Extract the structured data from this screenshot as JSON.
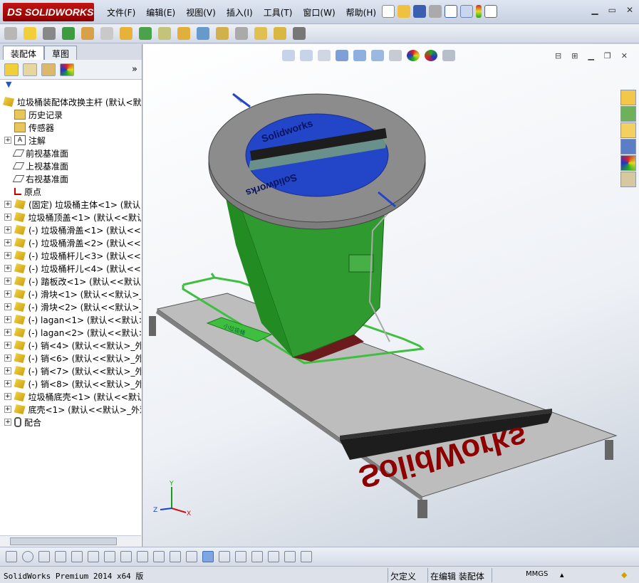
{
  "app": {
    "logo_text": "SOLIDWORKS",
    "logo_mark": "DS"
  },
  "menu": [
    "文件(F)",
    "编辑(E)",
    "视图(V)",
    "插入(I)",
    "工具(T)",
    "窗口(W)",
    "帮助(H)"
  ],
  "left_panel": {
    "tabs": [
      "装配体",
      "草图"
    ],
    "tree": [
      {
        "icon": "part",
        "label": "垃圾桶装配体改换主杆  (默认<默",
        "expand": false,
        "root": true
      },
      {
        "icon": "folder",
        "label": "历史记录",
        "expand": false
      },
      {
        "icon": "folder",
        "label": "传感器",
        "expand": false
      },
      {
        "icon": "note",
        "label": "注解",
        "expand": true
      },
      {
        "icon": "plane",
        "label": "前视基准面",
        "expand": false
      },
      {
        "icon": "plane",
        "label": "上视基准面",
        "expand": false
      },
      {
        "icon": "plane",
        "label": "右视基准面",
        "expand": false
      },
      {
        "icon": "origin",
        "label": "原点",
        "expand": false
      },
      {
        "icon": "part",
        "label": "(固定) 垃圾桶主体<1> (默认",
        "expand": true
      },
      {
        "icon": "part",
        "label": "垃圾桶顶盖<1> (默认<<默认>",
        "expand": true
      },
      {
        "icon": "part",
        "label": "(-) 垃圾桶滑盖<1> (默认<<",
        "expand": true
      },
      {
        "icon": "part",
        "label": "(-) 垃圾桶滑盖<2> (默认<<",
        "expand": true
      },
      {
        "icon": "part",
        "label": "(-) 垃圾桶杆儿<3> (默认<<",
        "expand": true
      },
      {
        "icon": "part",
        "label": "(-) 垃圾桶杆儿<4> (默认<<",
        "expand": true
      },
      {
        "icon": "part",
        "label": "(-) 踏板改<1> (默认<<默认",
        "expand": true
      },
      {
        "icon": "part",
        "label": "(-) 滑块<1> (默认<<默认>_",
        "expand": true
      },
      {
        "icon": "part",
        "label": "(-) 滑块<2> (默认<<默认>_",
        "expand": true
      },
      {
        "icon": "part",
        "label": "(-) lagan<1> (默认<<默认>_",
        "expand": true
      },
      {
        "icon": "part",
        "label": "(-) lagan<2> (默认<<默认>_",
        "expand": true
      },
      {
        "icon": "part",
        "label": "(-) 销<4> (默认<<默认>_外观",
        "expand": true
      },
      {
        "icon": "part",
        "label": "(-) 销<6> (默认<<默认>_外观",
        "expand": true
      },
      {
        "icon": "part",
        "label": "(-) 销<7> (默认<<默认>_外观",
        "expand": true
      },
      {
        "icon": "part",
        "label": "(-) 销<8> (默认<<默认>_外观",
        "expand": true
      },
      {
        "icon": "part",
        "label": "垃圾桶底壳<1> (默认<<默认>",
        "expand": true
      },
      {
        "icon": "part",
        "label": "底壳<1> (默认<<默认>_外观",
        "expand": true
      },
      {
        "icon": "mate",
        "label": "配合",
        "expand": true
      }
    ]
  },
  "viewport": {
    "lid_text": "Solidworks",
    "base_text": "SolidWorks",
    "pedal_text": "小垃圾桶",
    "triad": {
      "x": "X",
      "y": "Y",
      "z": "Z"
    }
  },
  "statusbar": {
    "app": "SolidWorks Premium 2014 x64 版",
    "defined": "欠定义",
    "mode": "在编辑 装配体",
    "units": "MMGS"
  },
  "colors": {
    "bin": "#2f9a2f",
    "lid_ring": "#7d7d7d",
    "lid_blue": "#2345c8",
    "base": "#9a9a9a",
    "brand": "#b30000",
    "rails": "#3fbf3f"
  }
}
